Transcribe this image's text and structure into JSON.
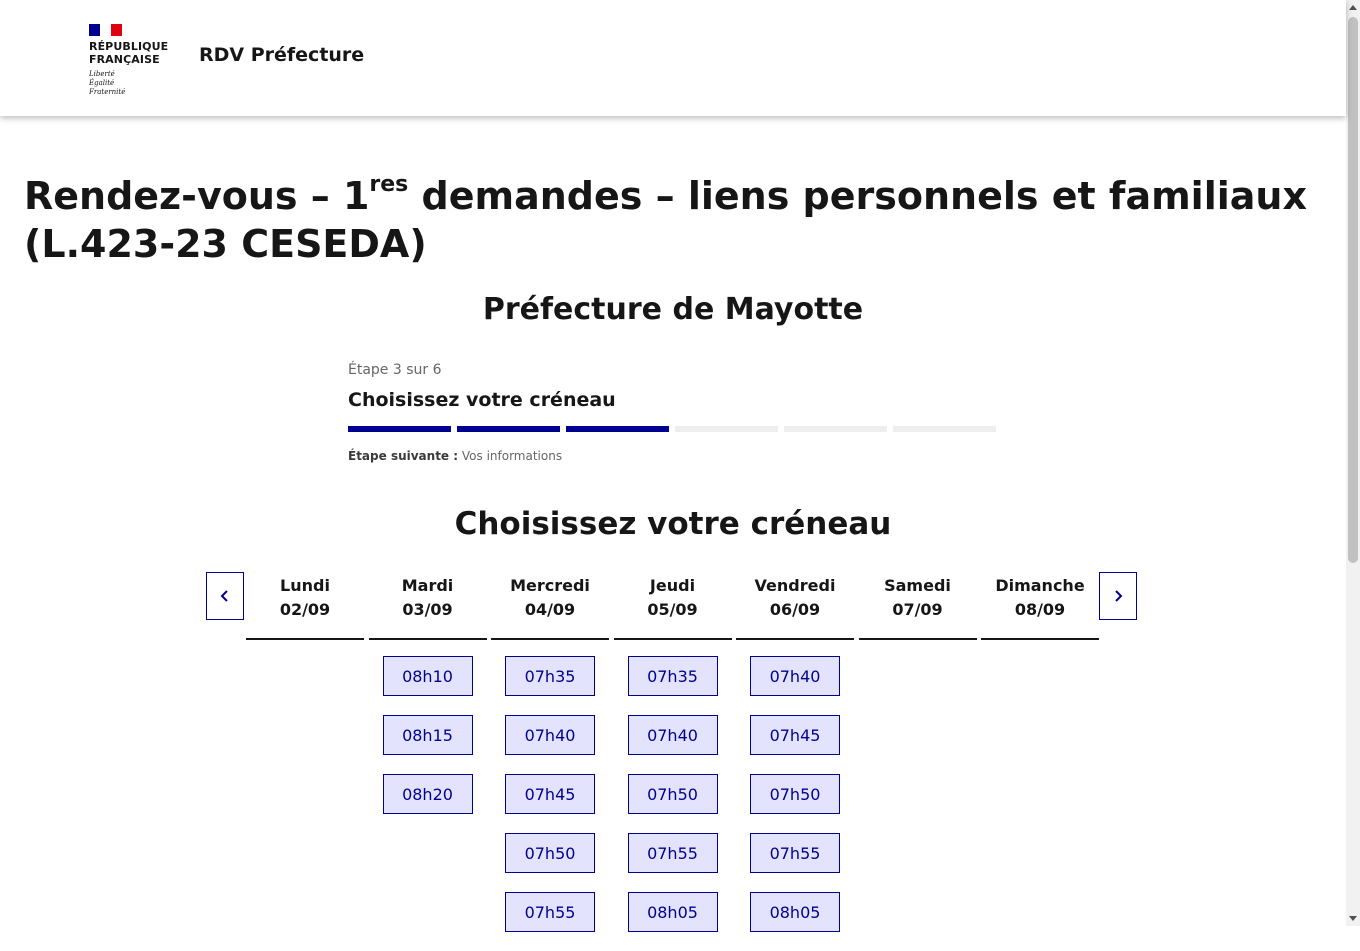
{
  "header": {
    "brand_line1": "RÉPUBLIQUE",
    "brand_line2": "FRANÇAISE",
    "motto_1": "Liberté",
    "motto_2": "Égalité",
    "motto_3": "Fraternité",
    "service_title": "RDV Préfecture",
    "flag_colors": [
      "#000091",
      "#ffffff",
      "#e1000f"
    ]
  },
  "page": {
    "title_part1": "Rendez-vous – 1",
    "title_sup": "res",
    "title_part2": " demandes – liens personnels et familiaux (L.423-23 CESEDA)",
    "prefecture": "Préfecture de Mayotte"
  },
  "stepper": {
    "state": "Étape 3 sur 6",
    "title": "Choisissez votre créneau",
    "current_step": 3,
    "total_steps": 6,
    "next_label": "Étape suivante :",
    "next_value": "Vos informations"
  },
  "calendar": {
    "section_title": "Choisissez votre créneau",
    "prev_icon": "chevron-left-icon",
    "next_icon": "chevron-right-icon",
    "days": [
      {
        "name": "Lundi",
        "date": "02/09",
        "slots": []
      },
      {
        "name": "Mardi",
        "date": "03/09",
        "slots": [
          "08h10",
          "08h15",
          "08h20"
        ]
      },
      {
        "name": "Mercredi",
        "date": "04/09",
        "slots": [
          "07h35",
          "07h40",
          "07h45",
          "07h50",
          "07h55"
        ]
      },
      {
        "name": "Jeudi",
        "date": "05/09",
        "slots": [
          "07h35",
          "07h40",
          "07h50",
          "07h55",
          "08h05"
        ]
      },
      {
        "name": "Vendredi",
        "date": "06/09",
        "slots": [
          "07h40",
          "07h45",
          "07h50",
          "07h55",
          "08h05"
        ]
      },
      {
        "name": "Samedi",
        "date": "07/09",
        "slots": []
      },
      {
        "name": "Dimanche",
        "date": "08/09",
        "slots": []
      }
    ]
  },
  "colors": {
    "primary": "#000091",
    "slot_bg": "#e3e3fd",
    "text": "#161616"
  }
}
